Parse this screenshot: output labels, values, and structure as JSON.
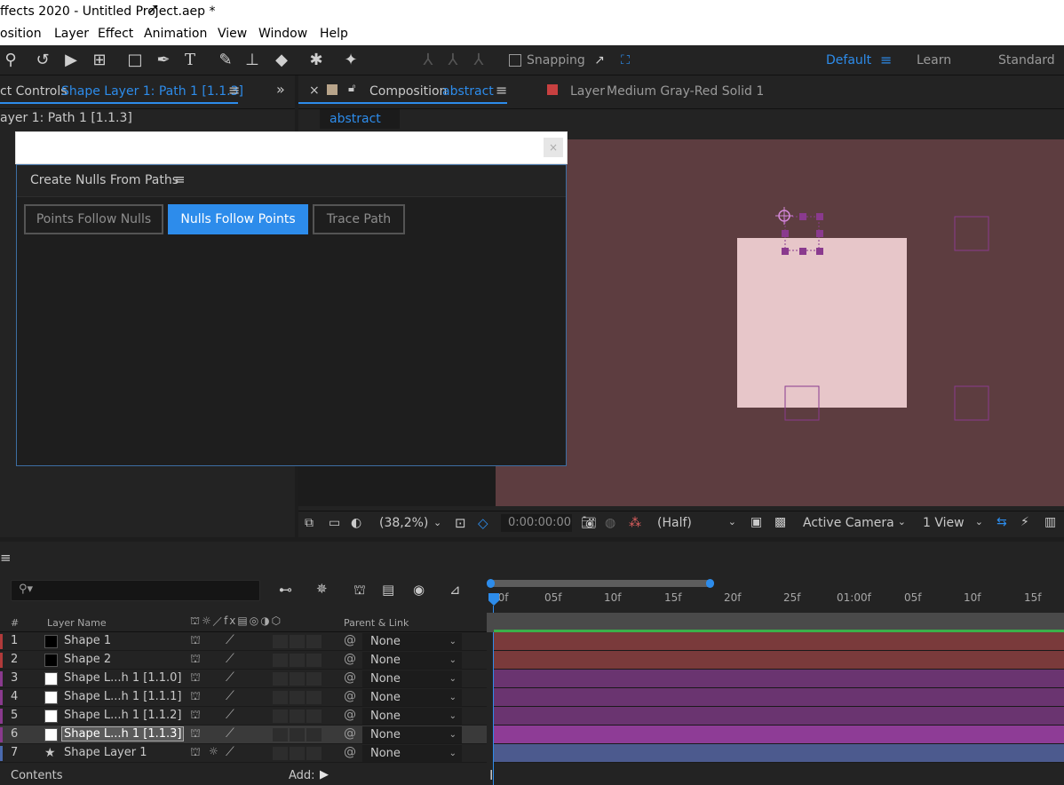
{
  "window": {
    "title": "ffects 2020 - Untitled Project.aep *"
  },
  "menu": [
    "osition",
    "Layer",
    "Effect",
    "Animation",
    "View",
    "Window",
    "Help"
  ],
  "toolbar": {
    "snapping_label": "Snapping",
    "workspaces": [
      "Default",
      "Learn",
      "Standard"
    ]
  },
  "effect_controls": {
    "tab_prefix": "ct Controls",
    "tab_layer": "Shape Layer 1: Path 1 [1.1.3]",
    "subtitle": "ayer 1: Path 1 [1.1.3]"
  },
  "composition_panel": {
    "close": "×",
    "tab_prefix": "Composition",
    "tab_name": "abstract",
    "layer_tab_prefix": "Layer",
    "layer_tab_name": "Medium Gray-Red Solid 1",
    "subtab": "abstract"
  },
  "dialog": {
    "close": "×",
    "title": "Create Nulls From Paths",
    "buttons": [
      "Points Follow Nulls",
      "Nulls Follow Points",
      "Trace Path"
    ],
    "active_button": "Nulls Follow Points"
  },
  "viewer_footer": {
    "zoom": "(38,2%)",
    "timecode": "0:00:00:00",
    "resolution": "(Half)",
    "camera": "Active Camera",
    "views": "1 View"
  },
  "timeline": {
    "columns": {
      "num": "#",
      "layer_name": "Layer Name",
      "parent": "Parent & Link"
    },
    "ruler_ticks": [
      "00f",
      "05f",
      "10f",
      "15f",
      "20f",
      "25f",
      "01:00f",
      "05f",
      "10f",
      "15f"
    ],
    "layers": [
      {
        "num": "1",
        "name": "Shape 1",
        "label_color": "#b03a3a",
        "swatch": "#000000",
        "parent": "None",
        "bar_color": "#7a3a3b"
      },
      {
        "num": "2",
        "name": "Shape 2",
        "label_color": "#b03a3a",
        "swatch": "#000000",
        "parent": "None",
        "bar_color": "#7a3a3b"
      },
      {
        "num": "3",
        "name": "Shape L...h 1 [1.1.0]",
        "label_color": "#8a3a8e",
        "swatch": "#ffffff",
        "parent": "None",
        "bar_color": "#6a3470"
      },
      {
        "num": "4",
        "name": "Shape L...h 1 [1.1.1]",
        "label_color": "#8a3a8e",
        "swatch": "#ffffff",
        "parent": "None",
        "bar_color": "#6a3470"
      },
      {
        "num": "5",
        "name": "Shape L...h 1 [1.1.2]",
        "label_color": "#8a3a8e",
        "swatch": "#ffffff",
        "parent": "None",
        "bar_color": "#6a3470"
      },
      {
        "num": "6",
        "name": "Shape L...h 1 [1.1.3]",
        "label_color": "#8a3a8e",
        "swatch": "#ffffff",
        "parent": "None",
        "bar_color": "#8e3c96",
        "selected": true
      },
      {
        "num": "7",
        "name": "Shape Layer 1",
        "label_color": "#4a6aae",
        "swatch": "star",
        "parent": "None",
        "bar_color": "#4c5a8e"
      }
    ],
    "footer_contents": "Contents",
    "footer_add": "Add:"
  }
}
